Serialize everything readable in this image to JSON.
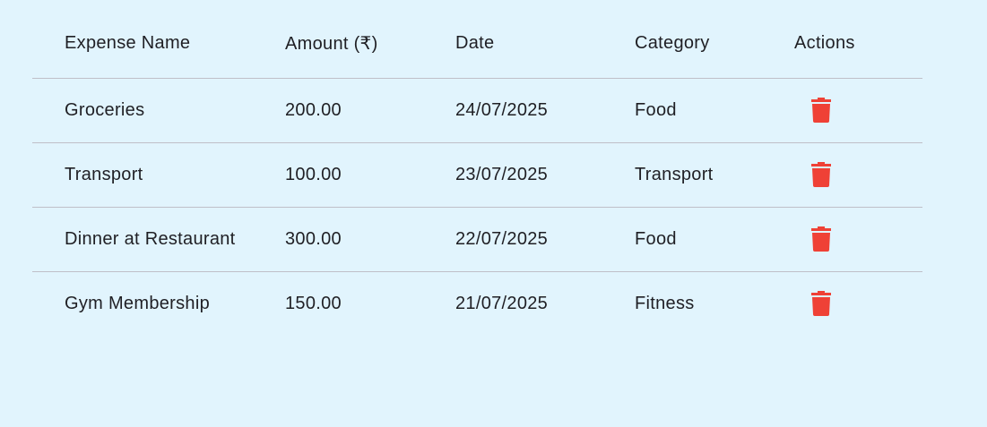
{
  "colors": {
    "background": "#e1f4fd",
    "divider": "#bfbfc8",
    "delete_icon": "#ef4136",
    "text": "#1f1f24"
  },
  "table": {
    "headers": [
      "Expense Name",
      "Amount (₹)",
      "Date",
      "Category",
      "Actions"
    ],
    "rows": [
      {
        "name": "Groceries",
        "amount": "200.00",
        "date": "24/07/2025",
        "category": "Food",
        "action_icon": "trash-icon"
      },
      {
        "name": "Transport",
        "amount": "100.00",
        "date": "23/07/2025",
        "category": "Transport",
        "action_icon": "trash-icon"
      },
      {
        "name": "Dinner at Restaurant",
        "amount": "300.00",
        "date": "22/07/2025",
        "category": "Food",
        "action_icon": "trash-icon"
      },
      {
        "name": "Gym Membership",
        "amount": "150.00",
        "date": "21/07/2025",
        "category": "Fitness",
        "action_icon": "trash-icon"
      }
    ]
  }
}
